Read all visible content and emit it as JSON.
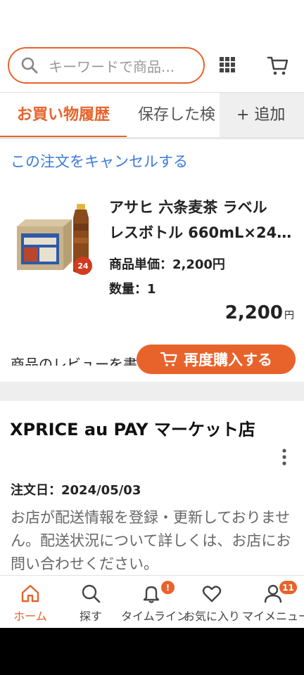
{
  "search": {
    "placeholder": "キーワードで商品..."
  },
  "tabs": [
    {
      "label": "お買い物履歴"
    },
    {
      "label": "保存した検"
    },
    {
      "label": "+ 追加"
    }
  ],
  "order": {
    "cancel_link": "この注文をキャンセルする",
    "product_name_line1": "アサヒ 六条麦茶 ラベル",
    "product_name_line2": "レスボトル 660mL×24...",
    "unit_price": "商品単価：2,200円",
    "quantity": "数量：1",
    "total": "2,200",
    "total_unit": "円",
    "review_text": "商品のレビューを書く",
    "rebuy_button": "再度購入する",
    "shop_name": "XPRICE au PAY マーケット店",
    "order_date": "注文日：2024/05/03",
    "shipping_note": "お店が配送情報を登録・更新しておりません。配送状況について詳しくは、お店にお問い合わせください。"
  },
  "bottom_nav": {
    "home": "ホーム",
    "search": "探す",
    "timeline": "タイムライン",
    "favorites": "お気に入り",
    "mymenu": "マイメニュー",
    "timeline_badge": "!",
    "mymenu_badge": "11"
  },
  "colors": {
    "accent": "#e8632b",
    "link": "#3b7bd6"
  }
}
